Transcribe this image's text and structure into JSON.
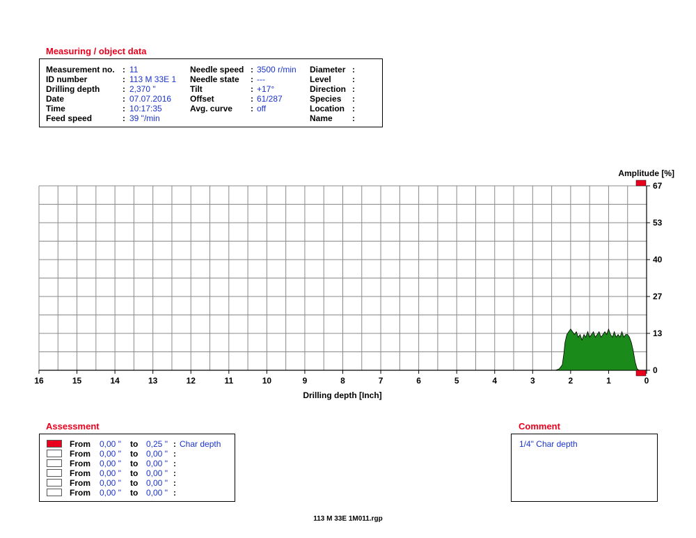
{
  "measuring": {
    "title": "Measuring / object data",
    "col1": [
      {
        "label": "Measurement no.",
        "value": "11"
      },
      {
        "label": "ID number",
        "value": "113 M 33E 1"
      },
      {
        "label": "Drilling depth",
        "value": "2,370 \""
      },
      {
        "label": "Date",
        "value": "07.07.2016"
      },
      {
        "label": "Time",
        "value": "10:17:35"
      },
      {
        "label": "Feed speed",
        "value": "39 \"/min"
      }
    ],
    "col2": [
      {
        "label": "Needle speed",
        "value": "3500 r/min"
      },
      {
        "label": "Needle state",
        "value": "---"
      },
      {
        "label": "Tilt",
        "value": "+17°"
      },
      {
        "label": "Offset",
        "value": "61/287"
      },
      {
        "label": "Avg. curve",
        "value": "off"
      }
    ],
    "col3": [
      {
        "label": "Diameter",
        "value": ""
      },
      {
        "label": "Level",
        "value": ""
      },
      {
        "label": "Direction",
        "value": ""
      },
      {
        "label": "Species",
        "value": ""
      },
      {
        "label": "Location",
        "value": ""
      },
      {
        "label": "Name",
        "value": ""
      }
    ]
  },
  "chart_data": {
    "type": "area",
    "xlabel": "Drilling depth [Inch]",
    "ylabel": "Amplitude [%]",
    "xlim": [
      16,
      0
    ],
    "ylim": [
      0,
      67
    ],
    "x_ticks": [
      "16",
      "15",
      "14",
      "13",
      "12",
      "11",
      "10",
      "9",
      "8",
      "7",
      "6",
      "5",
      "4",
      "3",
      "2",
      "1",
      "0"
    ],
    "y_ticks": [
      "0",
      "13",
      "27",
      "40",
      "53",
      "67"
    ],
    "grid": true,
    "fill_color": "#1a8a1a",
    "marker_color": "#e8001c",
    "series": [
      {
        "x": [
          2.4,
          2.3,
          2.22,
          2.18,
          2.15,
          2.1,
          2.05,
          2.0,
          1.95,
          1.9,
          1.85,
          1.8,
          1.75,
          1.7,
          1.65,
          1.6,
          1.55,
          1.5,
          1.45,
          1.4,
          1.35,
          1.3,
          1.25,
          1.2,
          1.15,
          1.1,
          1.05,
          1.0,
          0.95,
          0.9,
          0.85,
          0.8,
          0.75,
          0.7,
          0.65,
          0.6,
          0.55,
          0.5,
          0.45,
          0.4,
          0.35,
          0.3,
          0.25,
          0.2
        ],
        "y": [
          0,
          0.5,
          2,
          6,
          10,
          13,
          14,
          15,
          14,
          13,
          14,
          12,
          13,
          11,
          13,
          12,
          14,
          12,
          13,
          14,
          12,
          13,
          14,
          12,
          13,
          14,
          13,
          15,
          13,
          12,
          14,
          12,
          13,
          12,
          14,
          12,
          13,
          13,
          12,
          10,
          7,
          3,
          0.5,
          0
        ]
      }
    ]
  },
  "assessment": {
    "title": "Assessment",
    "rows": [
      {
        "color": "#e8001c",
        "from_label": "From",
        "from": "0,00 \"",
        "to_label": "to",
        "to": "0,25 \"",
        "desc": "Char depth"
      },
      {
        "color": "#ffffff",
        "from_label": "From",
        "from": "0,00 \"",
        "to_label": "to",
        "to": "0,00 \"",
        "desc": ""
      },
      {
        "color": "#ffffff",
        "from_label": "From",
        "from": "0,00 \"",
        "to_label": "to",
        "to": "0,00 \"",
        "desc": ""
      },
      {
        "color": "#ffffff",
        "from_label": "From",
        "from": "0,00 \"",
        "to_label": "to",
        "to": "0,00 \"",
        "desc": ""
      },
      {
        "color": "#ffffff",
        "from_label": "From",
        "from": "0,00 \"",
        "to_label": "to",
        "to": "0,00 \"",
        "desc": ""
      },
      {
        "color": "#ffffff",
        "from_label": "From",
        "from": "0,00 \"",
        "to_label": "to",
        "to": "0,00 \"",
        "desc": ""
      }
    ]
  },
  "comment": {
    "title": "Comment",
    "text": "1/4\" Char depth"
  },
  "footer": "113 M 33E 1M011.rgp"
}
